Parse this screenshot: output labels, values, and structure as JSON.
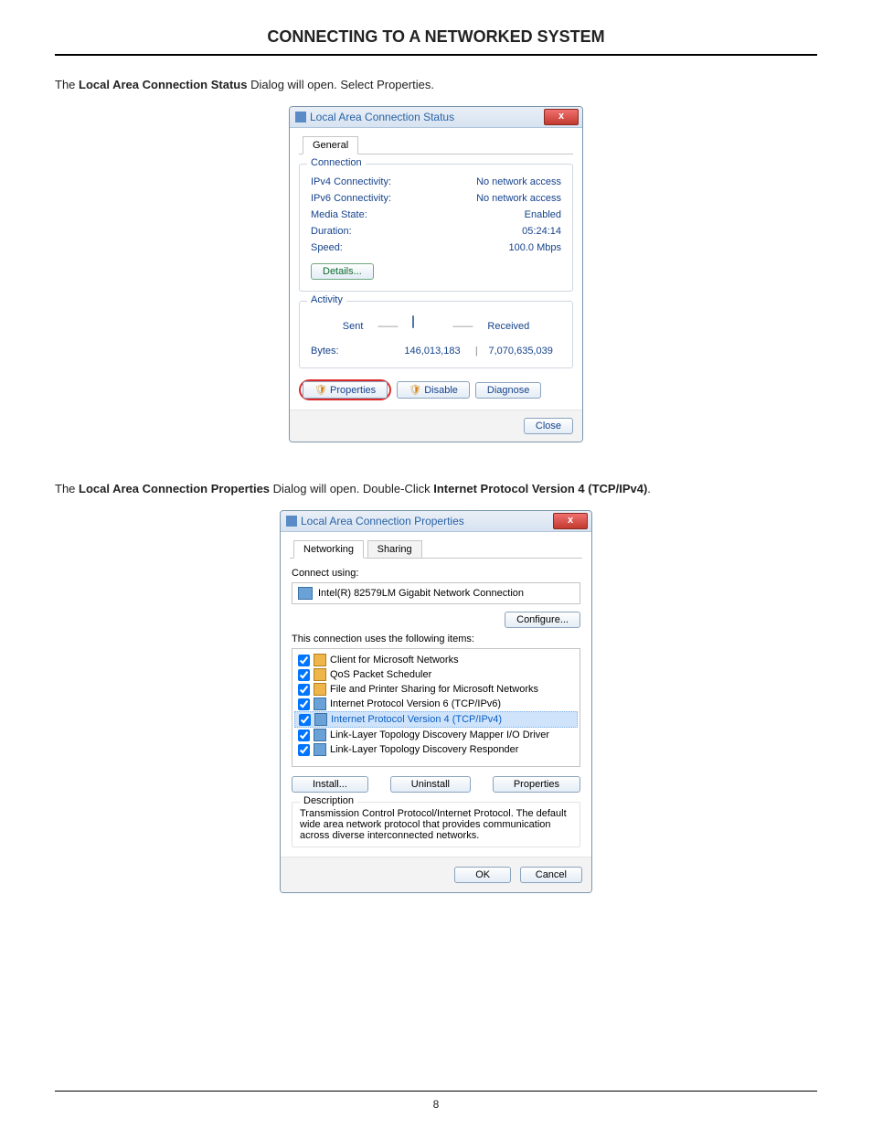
{
  "doc": {
    "title": "CONNECTING TO A NETWORKED SYSTEM",
    "para1_pre": "The ",
    "para1_bold": "Local Area Connection Status",
    "para1_post": " Dialog will open. Select Properties.",
    "para2_a": "The ",
    "para2_b": "Local Area Connection Properties",
    "para2_c": " Dialog will open. Double-Click ",
    "para2_d": "Internet Protocol Version 4 (TCP/IPv4)",
    "para2_e": ".",
    "page_number": "8"
  },
  "status_dialog": {
    "title": "Local Area Connection Status",
    "close_x": "x",
    "tab_general": "General",
    "connection_legend": "Connection",
    "ipv4_label": "IPv4 Connectivity:",
    "ipv4_value": "No network access",
    "ipv6_label": "IPv6 Connectivity:",
    "ipv6_value": "No network access",
    "media_label": "Media State:",
    "media_value": "Enabled",
    "duration_label": "Duration:",
    "duration_value": "05:24:14",
    "speed_label": "Speed:",
    "speed_value": "100.0 Mbps",
    "details_btn": "Details...",
    "activity_legend": "Activity",
    "sent_label": "Sent",
    "received_label": "Received",
    "bytes_label": "Bytes:",
    "bytes_sent": "146,013,183",
    "bytes_received": "7,070,635,039",
    "properties_btn": "Properties",
    "disable_btn": "Disable",
    "diagnose_btn": "Diagnose",
    "close_btn": "Close"
  },
  "props_dialog": {
    "title": "Local Area Connection Properties",
    "close_x": "x",
    "tab_networking": "Networking",
    "tab_sharing": "Sharing",
    "connect_using_label": "Connect using:",
    "adapter_name": "Intel(R) 82579LM Gigabit Network Connection",
    "configure_btn": "Configure...",
    "items_label": "This connection uses the following items:",
    "items": [
      "Client for Microsoft Networks",
      "QoS Packet Scheduler",
      "File and Printer Sharing for Microsoft Networks",
      "Internet Protocol Version 6 (TCP/IPv6)",
      "Internet Protocol Version 4 (TCP/IPv4)",
      "Link-Layer Topology Discovery Mapper I/O Driver",
      "Link-Layer Topology Discovery Responder"
    ],
    "install_btn": "Install...",
    "uninstall_btn": "Uninstall",
    "properties_btn": "Properties",
    "desc_legend": "Description",
    "desc_text": "Transmission Control Protocol/Internet Protocol. The default wide area network protocol that provides communication across diverse interconnected networks.",
    "ok_btn": "OK",
    "cancel_btn": "Cancel"
  }
}
